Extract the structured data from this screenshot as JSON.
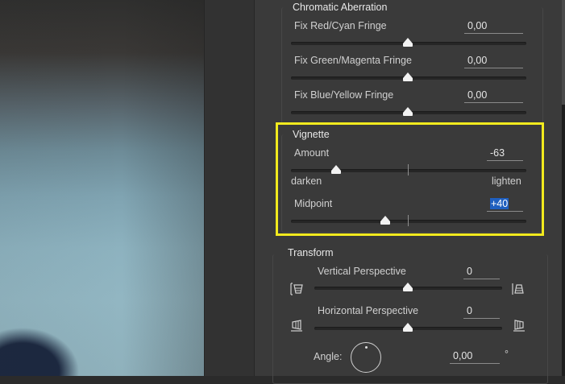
{
  "chromatic_aberration": {
    "title": "Chromatic Aberration",
    "sliders": [
      {
        "label": "Fix Red/Cyan Fringe",
        "value": "0,00",
        "position": 0.5
      },
      {
        "label": "Fix Green/Magenta Fringe",
        "value": "0,00",
        "position": 0.5
      },
      {
        "label": "Fix Blue/Yellow Fringe",
        "value": "0,00",
        "position": 0.5
      }
    ]
  },
  "vignette": {
    "title": "Vignette",
    "amount": {
      "label": "Amount",
      "value": "-63",
      "min_label": "darken",
      "max_label": "lighten",
      "position": 0.19
    },
    "midpoint": {
      "label": "Midpoint",
      "value": "+40",
      "position": 0.4
    }
  },
  "transform": {
    "title": "Transform",
    "vertical": {
      "label": "Vertical Perspective",
      "value": "0",
      "position": 0.5
    },
    "horizontal": {
      "label": "Horizontal Perspective",
      "value": "0",
      "position": 0.5
    },
    "angle": {
      "label": "Angle:",
      "value": "0,00",
      "unit": "°"
    }
  },
  "colors": {
    "highlight_border": "#f2ea1e",
    "selection": "#1f5fbf"
  },
  "icons": [
    "vertical-perspective-left-icon",
    "vertical-perspective-right-icon",
    "horizontal-perspective-left-icon",
    "horizontal-perspective-right-icon",
    "angle-dial-icon"
  ]
}
